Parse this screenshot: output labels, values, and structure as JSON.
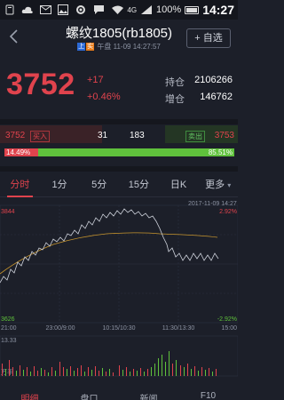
{
  "status_bar": {
    "battery": "100%",
    "time": "14:27",
    "network": "4G"
  },
  "header": {
    "title": "螺纹1805(rb1805)",
    "exchange_tag": "上",
    "delay_tag": "实",
    "session": "午盘",
    "datetime": "11-09 14:27:57",
    "add_favorite": "+ 自选"
  },
  "quote": {
    "price": "3752",
    "change": "+17",
    "change_pct": "+0.46%",
    "open_interest_label": "持仓",
    "open_interest": "2106266",
    "oi_change_label": "增仓",
    "oi_change": "146762"
  },
  "order_book": {
    "buy_price": "3752",
    "buy_label": "买入",
    "buy_volume": "31",
    "sell_volume": "183",
    "sell_label": "卖出",
    "sell_price": "3753",
    "buy_pct": "14.49%",
    "sell_pct": "85.51%",
    "buy_ratio": 0.1449
  },
  "tabs": [
    "分时",
    "1分",
    "5分",
    "15分",
    "日K",
    "更多"
  ],
  "chart": {
    "date": "2017-11-09 14:27",
    "high_price": "3844",
    "high_pct": "2.92%",
    "low_price": "3626",
    "low_pct": "-2.92%",
    "times": [
      "21:00",
      "23:00/9:00",
      "10:15/10:30",
      "11:30/13:30",
      "15:00"
    ],
    "volume_label": "13.33",
    "volume_unit": "万手"
  },
  "colors": {
    "up": "#e0434d",
    "down": "#5fc13c",
    "avg": "#c8962e"
  },
  "bottom_nav": [
    "明细",
    "盘口",
    "新闻",
    "F10"
  ]
}
